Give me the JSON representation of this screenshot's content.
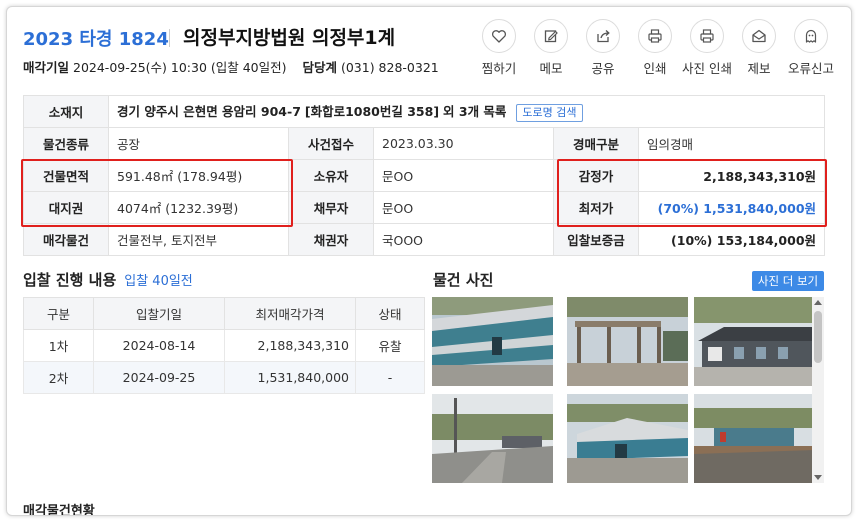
{
  "header": {
    "case_no": "2023 타경 1824",
    "court": "의정부지방법원 의정부1계",
    "sale_date_label": "매각기일",
    "sale_date_value": "2024-09-25(수) 10:30 (입찰 40일전)",
    "dept_label": "담당계",
    "dept_value": "(031) 828-0321"
  },
  "actions": [
    {
      "label": "찜하기",
      "icon": "heart-icon"
    },
    {
      "label": "메모",
      "icon": "memo-icon"
    },
    {
      "label": "공유",
      "icon": "share-icon"
    },
    {
      "label": "인쇄",
      "icon": "print-icon"
    },
    {
      "label": "사진 인쇄",
      "icon": "print-icon"
    },
    {
      "label": "제보",
      "icon": "mail-icon"
    },
    {
      "label": "오류신고",
      "icon": "ghost-icon"
    }
  ],
  "info": {
    "address_label": "소재지",
    "address_value": "경기 양주시 은현면 용암리 904-7",
    "address_road": "[화합로1080번길 358]",
    "address_extra": "외 3개 목록",
    "road_search_btn": "도로명 검색",
    "type_label": "물건종류",
    "type_value": "공장",
    "received_label": "사건접수",
    "received_value": "2023.03.30",
    "auction_type_label": "경매구분",
    "auction_type_value": "임의경매",
    "building_area_label": "건물면적",
    "building_area_value": "591.48㎡ (178.94평)",
    "owner_label": "소유자",
    "owner_value": "문OO",
    "appraisal_label": "감정가",
    "appraisal_value": "2,188,343,310원",
    "land_label": "대지권",
    "land_value": "4074㎡ (1232.39평)",
    "debtor_label": "채무자",
    "debtor_value": "문OO",
    "minimum_label": "최저가",
    "minimum_value": "(70%) 1,531,840,000원",
    "sale_item_label": "매각물건",
    "sale_item_value": "건물전부, 토지전부",
    "creditor_label": "채권자",
    "creditor_value": "국OOO",
    "deposit_label": "입찰보증금",
    "deposit_value": "(10%) 153,184,000원"
  },
  "bid": {
    "title": "입찰 진행 내용",
    "subtitle": "입찰 40일전",
    "headers": [
      "구분",
      "입찰기일",
      "최저매각가격",
      "상태"
    ],
    "rows": [
      [
        "1차",
        "2024-08-14",
        "2,188,343,310",
        "유찰"
      ],
      [
        "2차",
        "2024-09-25",
        "1,531,840,000",
        "-"
      ]
    ]
  },
  "photos": {
    "title": "물건 사진",
    "more_btn": "사진 더 보기"
  },
  "next_section_title": "매각물건현황",
  "colors": {
    "accent": "#2c6fd6",
    "highlight_border": "#e0201d",
    "button_blue": "#3d8ae6",
    "label_bg": "#f4f5f7"
  }
}
